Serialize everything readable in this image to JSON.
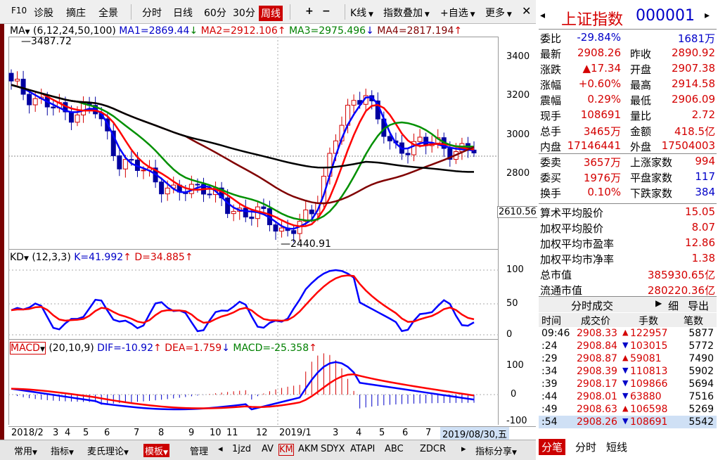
{
  "toolbar": {
    "items": [
      "F10",
      "诊股",
      "摘庄",
      "全景",
      "分时",
      "日线",
      "60分",
      "30分",
      "周线",
      "+",
      "−",
      "K线",
      "指数叠加",
      "自选",
      "更多"
    ]
  },
  "main_legend": {
    "ma_label": "MA",
    "ma_params": "(6,12,24,50,100)",
    "ma1": "MA1=2869.44",
    "ma2": "MA2=2912.106",
    "ma3": "MA3=2975.496",
    "ma4": "MA4=2817.194"
  },
  "kd_legend": {
    "label": "KD",
    "params": "(12,3,3)",
    "k": "K=41.992",
    "d": "D=34.885"
  },
  "macd_legend": {
    "label": "MACD",
    "params": "(20,10,9)",
    "dif": "DIF=-10.92",
    "dea": "DEA=1.759",
    "macd": "MACD=-25.358"
  },
  "price_axis": [
    "3400",
    "3200",
    "3000",
    "2800"
  ],
  "price_annotations": {
    "high": "3487.72",
    "low": "2440.91",
    "current": "2610.56"
  },
  "kd_axis": [
    "100",
    "50",
    "0"
  ],
  "macd_axis": [
    "100",
    "0",
    "-100"
  ],
  "time_axis": [
    "2018/2",
    "3",
    "4",
    "5",
    "6",
    "7",
    "8",
    "9",
    "10",
    "11",
    "12",
    "2019/1",
    "3",
    "4",
    "5",
    "6",
    "7"
  ],
  "date_box": "2019/08/30,五",
  "bottom_tabs": [
    "常用",
    "指标",
    "麦氏理论",
    "模板",
    "管理",
    "1jzd",
    "AV",
    "KM",
    "AKM",
    "SDYX",
    "ATAPI",
    "ABC",
    "ZDCR",
    "指标分享"
  ],
  "quote": {
    "title": "上证指数",
    "code": "000001",
    "rows": [
      {
        "l1": "委比",
        "v1": "-29.84%",
        "l2": "",
        "v2": "1681万"
      },
      {
        "l1": "最新",
        "v1": "2908.26",
        "l2": "昨收",
        "v2": "2890.92"
      },
      {
        "l1": "涨跌",
        "v1": "▲17.34",
        "l2": "开盘",
        "v2": "2907.38"
      },
      {
        "l1": "涨幅",
        "v1": "+0.60%",
        "l2": "最高",
        "v2": "2914.58"
      },
      {
        "l1": "震幅",
        "v1": "0.29%",
        "l2": "最低",
        "v2": "2906.09"
      },
      {
        "l1": "现手",
        "v1": "108691",
        "l2": "量比",
        "v2": "2.72"
      },
      {
        "l1": "总手",
        "v1": "3465万",
        "l2": "金额",
        "v2": "418.5亿"
      },
      {
        "l1": "内盘",
        "v1": "17146441",
        "l2": "外盘",
        "v2": "17504003"
      },
      {
        "l1": "委卖",
        "v1": "3657万",
        "l2": "上涨家数",
        "v2": "994"
      },
      {
        "l1": "委买",
        "v1": "1976万",
        "l2": "平盘家数",
        "v2": "117"
      },
      {
        "l1": "换手",
        "v1": "0.10%",
        "l2": "下跌家数",
        "v2": "384"
      }
    ],
    "stats": [
      {
        "label": "算术平均股价",
        "value": "15.05"
      },
      {
        "label": "加权平均股价",
        "value": "8.07"
      },
      {
        "label": "加权平均市盈率",
        "value": "12.86"
      },
      {
        "label": "加权平均市净率",
        "value": "1.38"
      },
      {
        "label": "总市值",
        "value": "385930.65亿"
      },
      {
        "label": "流通市值",
        "value": "280220.36亿"
      }
    ],
    "tick_header": {
      "tab": "分时成交",
      "detail": "细",
      "export": "导出"
    },
    "tick_cols": [
      "时间",
      "成交价",
      "手数",
      "笔数"
    ],
    "ticks": [
      {
        "t": "09:46",
        "p": "2908.33",
        "v": "122957",
        "n": "5877"
      },
      {
        "t": ":24",
        "p": "2908.84",
        "v": "103015",
        "n": "5772"
      },
      {
        "t": ":29",
        "p": "2908.87",
        "v": "59081",
        "n": "7490"
      },
      {
        "t": ":34",
        "p": "2908.39",
        "v": "110813",
        "n": "5902"
      },
      {
        "t": ":39",
        "p": "2908.17",
        "v": "109866",
        "n": "5694"
      },
      {
        "t": ":44",
        "p": "2908.01",
        "v": "63880",
        "n": "7516"
      },
      {
        "t": ":49",
        "p": "2908.63",
        "v": "106598",
        "n": "5269"
      },
      {
        "t": ":54",
        "p": "2908.26",
        "v": "108691",
        "n": "5542"
      }
    ],
    "footer_tabs": [
      "分笔",
      "分时",
      "短线"
    ]
  },
  "colors": {
    "up": "#d40000",
    "down": "#0000a0",
    "ma1": "#0000ff",
    "ma2": "#ff0000",
    "ma3": "#009000",
    "ma4": "#800000",
    "ma5": "#000000"
  },
  "chart_data": [
    {
      "type": "candlestick",
      "title": "上证指数 周线",
      "ylim": [
        2400,
        3500
      ],
      "x": [
        "2018/2",
        "2018/3",
        "2018/4",
        "2018/5",
        "2018/6",
        "2018/7",
        "2018/8",
        "2018/9",
        "2018/10",
        "2018/11",
        "2018/12",
        "2019/1",
        "2019/3",
        "2019/4",
        "2019/5",
        "2019/6",
        "2019/7",
        "2019/8"
      ],
      "close": [
        3250,
        3170,
        3100,
        3140,
        2850,
        2800,
        2680,
        2740,
        2600,
        2590,
        2490,
        2560,
        3020,
        3230,
        2900,
        2960,
        2920,
        2908
      ],
      "series": [
        {
          "name": "MA1",
          "last": 2869.44
        },
        {
          "name": "MA2",
          "last": 2912.106
        },
        {
          "name": "MA3",
          "last": 2975.496
        },
        {
          "name": "MA4",
          "last": 2817.194
        }
      ]
    },
    {
      "type": "line",
      "title": "KD",
      "ylim": [
        0,
        100
      ],
      "series": [
        {
          "name": "K",
          "last": 41.992
        },
        {
          "name": "D",
          "last": 34.885
        }
      ]
    },
    {
      "type": "bar",
      "title": "MACD",
      "ylim": [
        -100,
        100
      ],
      "series": [
        {
          "name": "DIF",
          "last": -10.92
        },
        {
          "name": "DEA",
          "last": 1.759
        },
        {
          "name": "MACD",
          "last": -25.358
        }
      ]
    }
  ]
}
